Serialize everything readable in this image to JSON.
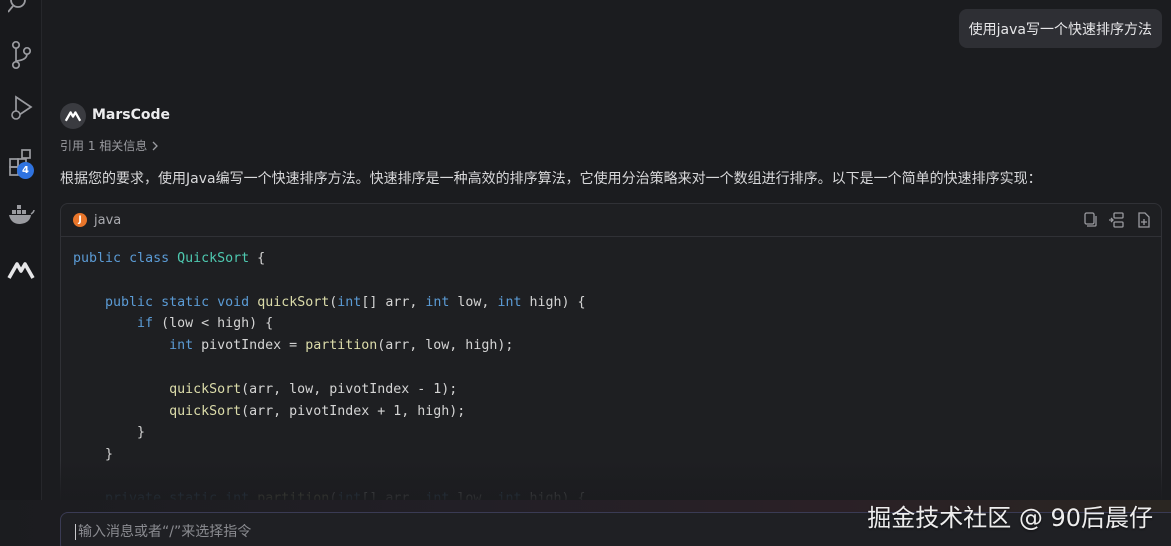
{
  "activity_bar": {
    "icons": [
      "search-icon",
      "source-control-icon",
      "run-debug-icon",
      "extensions-icon",
      "docker-icon",
      "marscode-icon",
      "account-icon"
    ],
    "extensions_badge": "4"
  },
  "chat": {
    "user_message": "使用java写一个快速排序方法",
    "assistant_name": "MarsCode",
    "citation": "引用 1 相关信息",
    "intro": "根据您的要求，使用Java编写一个快速排序方法。快速排序是一种高效的排序算法，它使用分治策略来对一个数组进行排序。以下是一个简单的快速排序实现："
  },
  "code_block": {
    "language_icon": "J",
    "language": "java",
    "actions": [
      "copy-icon",
      "insert-icon",
      "new-file-icon"
    ]
  },
  "input": {
    "placeholder": "输入消息或者“/”来选择指令"
  },
  "watermark": "掘金技术社区 @ 90后晨仔",
  "colors": {
    "background": "#1b1c1f",
    "keyword": "#5b9bd5",
    "class_name": "#4ec9b0",
    "function_name": "#dcdcaa",
    "badge": "#2f73e0",
    "java_icon": "#e8752a"
  }
}
